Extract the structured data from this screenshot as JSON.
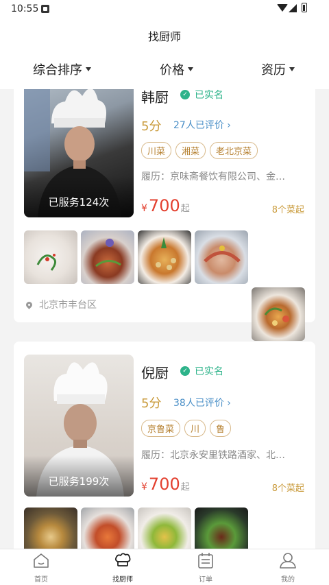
{
  "status": {
    "time": "10:55"
  },
  "header": {
    "title": "找厨师"
  },
  "filters": [
    {
      "label": "综合排序"
    },
    {
      "label": "价格"
    },
    {
      "label": "资历"
    }
  ],
  "chefs": [
    {
      "name": "韩厨",
      "verified": "已实名",
      "score": "5分",
      "reviews": "27人已评价",
      "tags": [
        "川菜",
        "湘菜",
        "老北京菜"
      ],
      "resume": "履历：京味斋餐饮有限公司、金…",
      "served": "已服务124次",
      "price_symbol": "¥",
      "price": "700",
      "price_suffix": "起",
      "dishes_count": "8个菜起",
      "location": "北京市丰台区"
    },
    {
      "name": "倪厨",
      "verified": "已实名",
      "score": "5分",
      "reviews": "38人已评价",
      "tags": [
        "京鲁菜",
        "川",
        "鲁"
      ],
      "resume": "履历：北京永安里铁路酒家、北…",
      "served": "已服务199次",
      "price_symbol": "¥",
      "price": "700",
      "price_suffix": "起",
      "dishes_count": "8个菜起"
    }
  ],
  "tabbar": [
    {
      "label": "首页",
      "icon": "home-icon"
    },
    {
      "label": "找厨师",
      "icon": "chef-hat-icon"
    },
    {
      "label": "订单",
      "icon": "order-icon"
    },
    {
      "label": "我的",
      "icon": "user-icon"
    }
  ],
  "colors": {
    "accent_gold": "#c99a3a",
    "price_red": "#e3402f",
    "verified_green": "#2db38a",
    "review_blue": "#4a8fc7"
  }
}
